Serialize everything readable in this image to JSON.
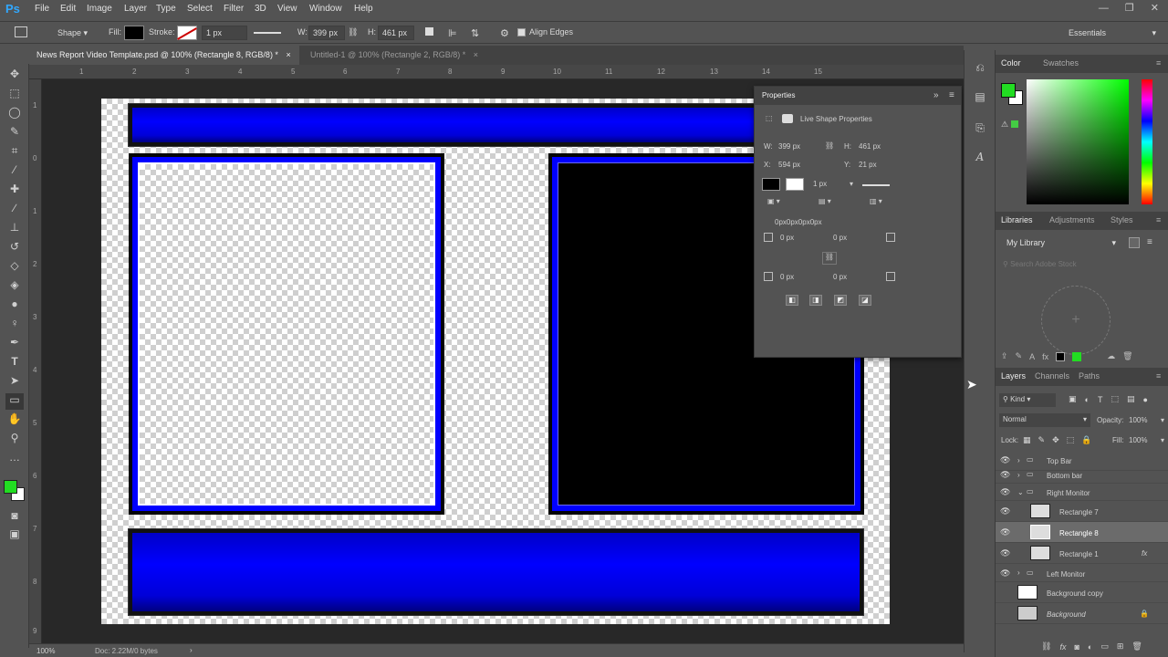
{
  "app": {
    "logo": "Ps"
  },
  "menu": [
    "File",
    "Edit",
    "Image",
    "Layer",
    "Type",
    "Select",
    "Filter",
    "3D",
    "View",
    "Window",
    "Help"
  ],
  "window_controls": {
    "minimize": "—",
    "restore": "❐",
    "close": "✕"
  },
  "options": {
    "mode": "Shape",
    "fill_label": "Fill:",
    "stroke_label": "Stroke:",
    "stroke_width": "1 px",
    "w_label": "W:",
    "w_value": "399 px",
    "link_icon": "⛓",
    "h_label": "H:",
    "h_value": "461 px",
    "align_edges": "Align Edges",
    "workspace": "Essentials"
  },
  "tabs": [
    {
      "label": "News Report Video Template.psd @ 100% (Rectangle 8, RGB/8) *",
      "close": "×"
    },
    {
      "label": "Untitled-1 @ 100% (Rectangle 2, RGB/8) *",
      "close": "×"
    }
  ],
  "ruler_top": [
    "1",
    "2",
    "3",
    "4",
    "5",
    "6",
    "7",
    "8",
    "9",
    "10",
    "11",
    "12",
    "13",
    "14",
    "15"
  ],
  "ruler_left": [
    "1",
    "0",
    "1",
    "2",
    "3",
    "4",
    "5",
    "6",
    "7",
    "8",
    "9"
  ],
  "properties": {
    "title": "Properties",
    "section": "Live Shape Properties",
    "w_label": "W:",
    "w": "399 px",
    "h_label": "H:",
    "h": "461 px",
    "x_label": "X:",
    "x": "594 px",
    "y_label": "Y:",
    "y": "21 px",
    "stroke_width": "1 px",
    "corners_label": "0px0px0px0px",
    "corner_tl": "0 px",
    "corner_tr": "0 px",
    "corner_bl": "0 px",
    "corner_br": "0 px"
  },
  "color_panel": {
    "tabs": [
      "Color",
      "Swatches"
    ],
    "foreground": "#22dd22"
  },
  "libraries_panel": {
    "tabs": [
      "Libraries",
      "Adjustments",
      "Styles"
    ],
    "library": "My Library",
    "search_placeholder": "Search Adobe Stock"
  },
  "layers_panel": {
    "tabs": [
      "Layers",
      "Channels",
      "Paths"
    ],
    "kind": "Kind",
    "blend": "Normal",
    "opacity_label": "Opacity:",
    "opacity": "100%",
    "lock_label": "Lock:",
    "fill_label": "Fill:",
    "fill": "100%",
    "layers": [
      {
        "name": "Top Bar",
        "type": "group",
        "expanded": false
      },
      {
        "name": "Bottom bar",
        "type": "group",
        "expanded": false
      },
      {
        "name": "Right Monitor",
        "type": "group",
        "expanded": true
      },
      {
        "name": "Rectangle 7",
        "type": "shape",
        "indent": true
      },
      {
        "name": "Rectangle 8",
        "type": "shape",
        "indent": true,
        "selected": true
      },
      {
        "name": "Rectangle 1",
        "type": "shape",
        "indent": true,
        "fx": "fx"
      },
      {
        "name": "Left Monitor",
        "type": "group",
        "expanded": false
      },
      {
        "name": "Background copy",
        "type": "pixel"
      },
      {
        "name": "Background",
        "type": "pixel",
        "locked": true
      }
    ]
  },
  "status": {
    "zoom": "100%",
    "doc": "Doc: 2.22M/0 bytes"
  }
}
